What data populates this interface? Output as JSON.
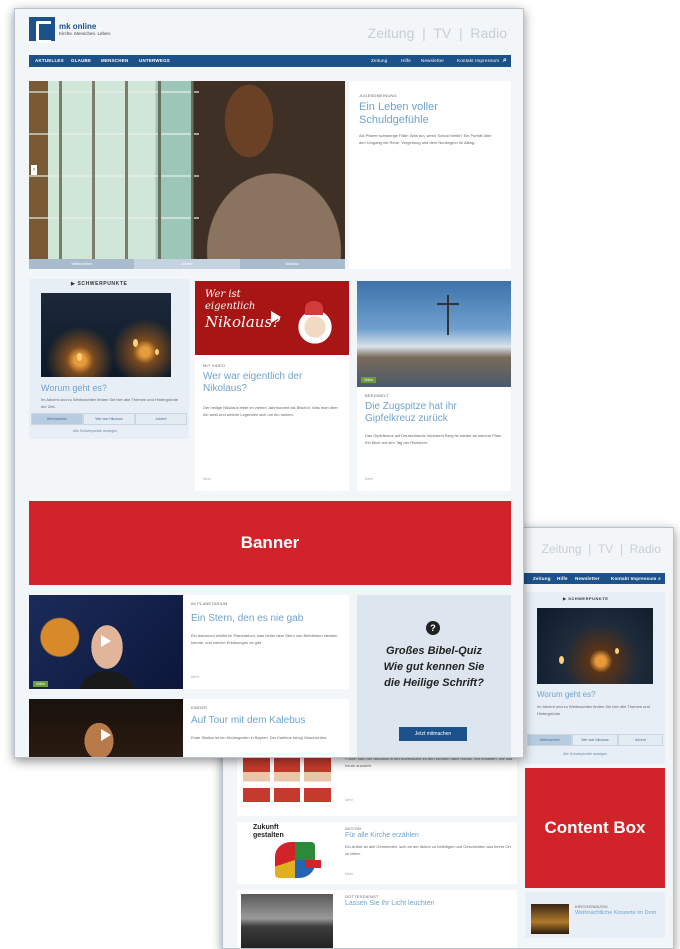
{
  "site": {
    "logo_name": "mk online",
    "logo_tagline": "Kirche. Menschen. Leben.",
    "top_links": [
      "Zeitung",
      "TV",
      "Radio"
    ],
    "logo_color": "#1d5189"
  },
  "nav": {
    "left": [
      "AKTUELLES",
      "GLAUBE",
      "MENSCHEN",
      "UNTERWEGS"
    ],
    "right": [
      "Zeitung",
      "Hilfe",
      "Newsletter",
      "Kontakt Impressum"
    ],
    "bg_color": "#1d5189"
  },
  "hero": {
    "kicker": "Jugendmeinung",
    "title": "Ein Leben voller Schuldgefühle",
    "teaser": "Als Pfarrer schwierige Fälle: Was tun, wenn Schuld bleibt? Ein Porträt über den Umgang mit Reue, Vergebung und dem Neubeginn im Alltag.",
    "thumb_labels": [
      "Weihnachten",
      "Advent",
      "Nikolaus"
    ]
  },
  "schwerpunkte": {
    "header": "SCHWERPUNKTE",
    "title": "Worum geht es?",
    "body": "Im Advent und zu Weihnachten finden Sie hier alle Themen und Hintergründe der Zeit.",
    "tabs": [
      "Weihnachten",
      "Wer war Nikolaus",
      "Advent"
    ],
    "footer_link": "Alle Schwerpunkte anzeigen"
  },
  "nikolaus": {
    "image_text_line1": "Wer ist",
    "image_text_line2": "eigentlich",
    "image_text_line3": "Nikolaus?",
    "kicker": "Mit Video",
    "title": "Wer war eigentlich der Nikolaus?",
    "body": "Der heilige Nikolaus lebte im vierten Jahrhundert als Bischof. Was man über ihn weiß und welche Legenden sich um ihn ranken.",
    "meta": "Mehr"
  },
  "zugspitze": {
    "badge": "Video",
    "kicker": "Bergwelt",
    "title": "Die Zugspitze hat ihr Gipfelkreuz zurück",
    "body": "Das Gipfelkreuz auf Deutschlands höchstem Berg ist wieder an seinem Platz. Ein Blick auf den Tag der Rückkehr.",
    "meta": "Mehr"
  },
  "banner": {
    "label": "Banner",
    "color": "#d2232a"
  },
  "stern": {
    "badge": "Video",
    "kicker": "Im Planetarium",
    "title": "Ein Stern, den es nie gab",
    "body": "Ein Astronom erklärt im Planetarium, was hinter dem Stern von Bethlehem stecken könnte, und welche Erklärungen es gibt.",
    "meta": "Mehr"
  },
  "kalebus": {
    "kicker": "Kinder",
    "title": "Auf Tour mit dem Kalebus",
    "body": "Erste Station ist ein Kindergarten in Bayern: Der Kalebus bringt Geschichten."
  },
  "quiz": {
    "title_line1": "Großes Bibel-Quiz",
    "title_line2": "Wie gut kennen Sie",
    "title_line3": "die Heilige Schrift?",
    "button": "Jetzt mitmachen"
  },
  "second": {
    "top_links": [
      "Zeitung",
      "TV",
      "Radio"
    ],
    "nav": [
      "Zeitung",
      "Hilfe",
      "Newsletter",
      "Kontakt Impressum"
    ],
    "schwerpunkte_header": "SCHWERPUNKTE",
    "schwerpunkte_title": "Worum geht es?",
    "schwerpunkte_body": "Im Advent und zu Weihnachten finden Sie hier alle Themen und Hintergründe.",
    "tabs": [
      "Weihnachten",
      "Wer war Nikolaus",
      "Advent"
    ],
    "footer_link": "Alle Schwerpunkte anzeigen",
    "content_box_label": "Content Box",
    "list": [
      {
        "kicker": "Brauchtum",
        "title": "",
        "body": "Früher kam der Nikolaus in der Adventszeit zu den Kindern nach Hause. Wir erzählen, wie das heute aussieht.",
        "meta": "Mehr"
      },
      {
        "kicker": "Aktion",
        "title": "Für alle Kirche erzählen",
        "body": "Ein Aufruf an alle Gemeinden, sich an der Aktion zu beteiligen und Geschichten aus ihrem Ort zu teilen.",
        "meta": "Mehr"
      },
      {
        "kicker": "Gottesdienst",
        "title": "Lassen Sie ihr Licht leuchten",
        "body": "",
        "meta": ""
      }
    ],
    "zukunft_text_1": "Zukunft",
    "zukunft_text_2": "gestalten",
    "side_item_kicker": "Kirchenmusik",
    "side_item_title": "Weihnachtliche Konzerte im Dom"
  }
}
